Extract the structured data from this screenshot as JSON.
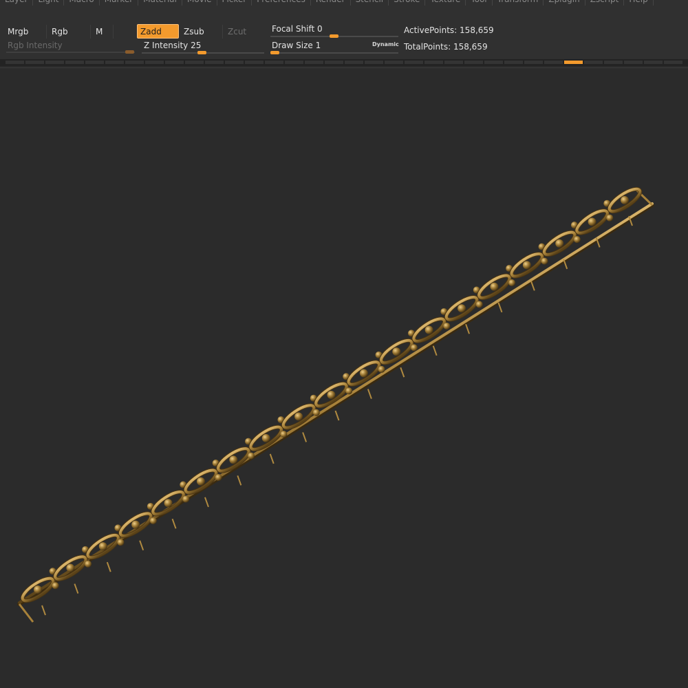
{
  "menubar": {
    "items": [
      "Layer",
      "Light",
      "Macro",
      "Marker",
      "Material",
      "Movie",
      "Picker",
      "Preferences",
      "Render",
      "Stencil",
      "Stroke",
      "Texture",
      "Tool",
      "Transform",
      "Zplugin",
      "Zscript",
      "Help"
    ]
  },
  "shelf": {
    "mrgb_label": "Mrgb",
    "rgb_label": "Rgb",
    "m_label": "M",
    "rgb_intensity_label": "Rgb Intensity",
    "zadd_label": "Zadd",
    "zsub_label": "Zsub",
    "zcut_label": "Zcut",
    "z_intensity_label": "Z Intensity",
    "z_intensity_value": "25",
    "focal_shift_label": "Focal Shift",
    "focal_shift_value": "0",
    "draw_size_label": "Draw Size",
    "draw_size_value": "1",
    "dynamic_label": "Dynamic",
    "active_points_label": "ActivePoints:",
    "active_points_value": "158,659",
    "total_points_label": "TotalPoints:",
    "total_points_value": "158,659"
  },
  "colors": {
    "accent": "#f39a2d",
    "background": "#2b2b2b",
    "panel": "#303030",
    "model_gold": "#a8823a"
  },
  "canvas": {
    "model": "chain-link-bracelet"
  }
}
